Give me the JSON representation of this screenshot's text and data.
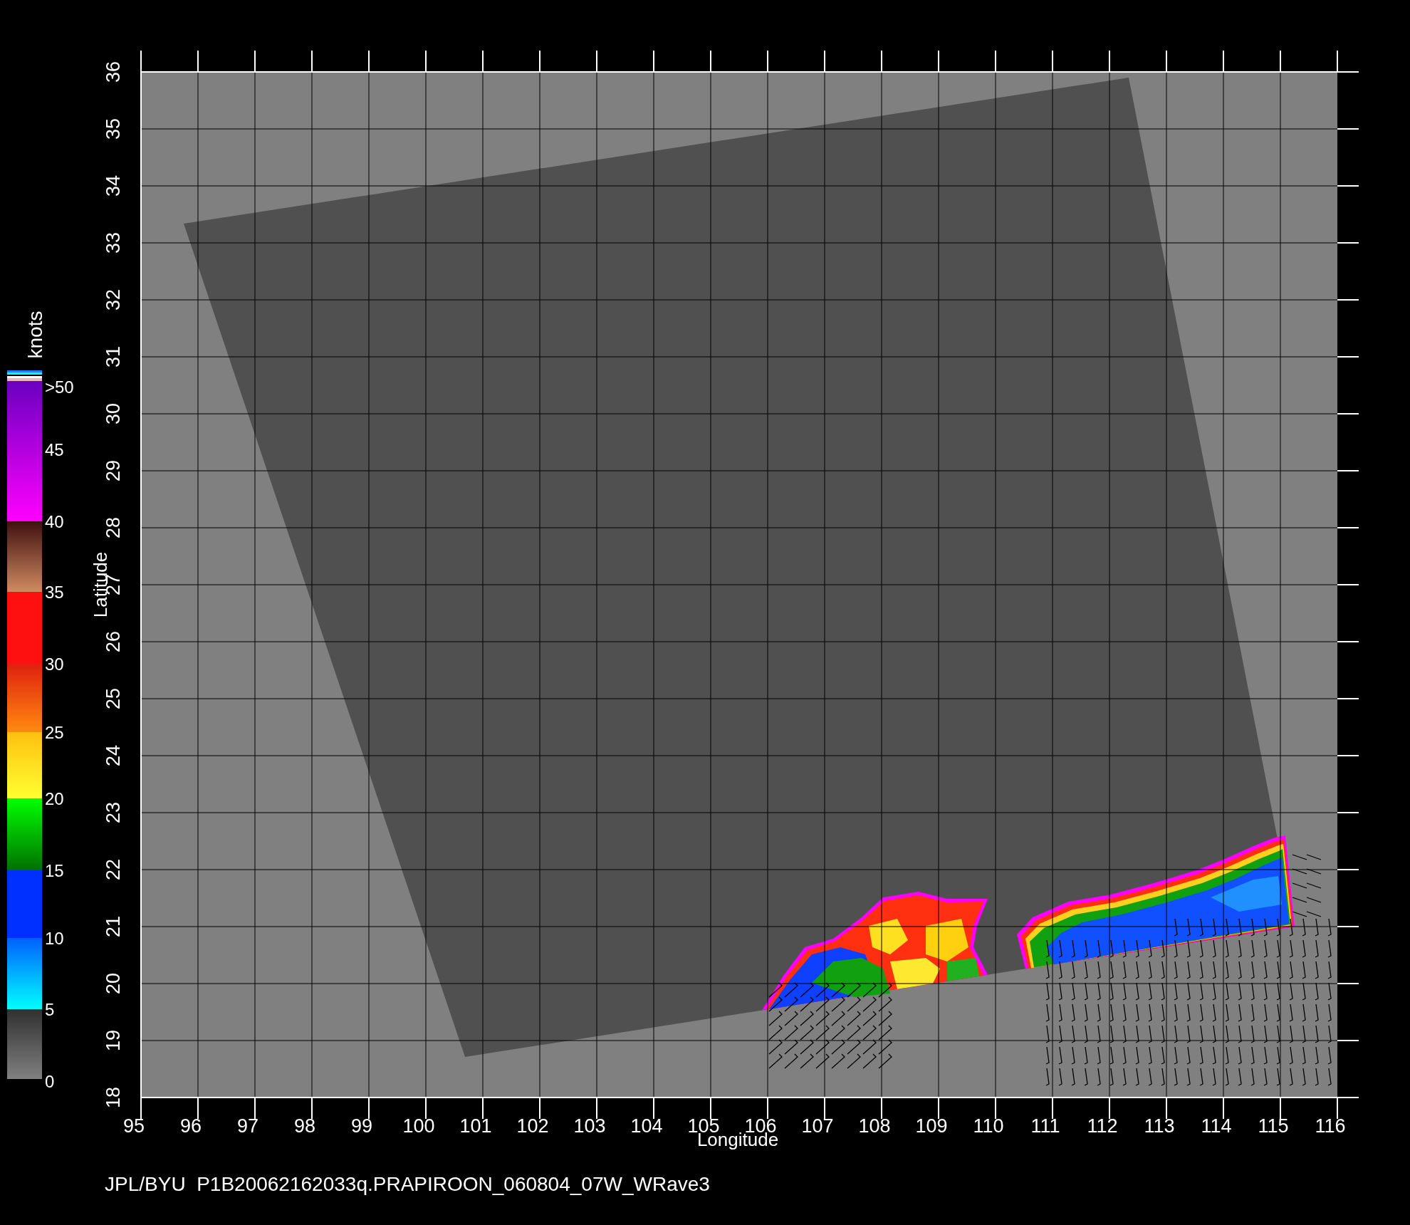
{
  "plot": {
    "x_axis": {
      "title": "Longitude",
      "ticks": [
        "95",
        "96",
        "97",
        "98",
        "99",
        "100",
        "101",
        "102",
        "103",
        "104",
        "105",
        "106",
        "107",
        "108",
        "109",
        "110",
        "111",
        "112",
        "113",
        "114",
        "115",
        "116"
      ]
    },
    "y_axis": {
      "title": "Latitude",
      "ticks": [
        "18",
        "19",
        "20",
        "21",
        "22",
        "23",
        "24",
        "25",
        "26",
        "27",
        "28",
        "29",
        "30",
        "31",
        "32",
        "33",
        "34",
        "35",
        "36"
      ]
    }
  },
  "colorbar": {
    "unit": "knots",
    "labels": [
      ">50",
      "45",
      "40",
      "35",
      "30",
      "25",
      "20",
      "15",
      "10",
      "5",
      "0"
    ]
  },
  "caption": "JPL/BYU  P1B20062162033q.PRAPIROON_060804_07W_WRave3"
}
